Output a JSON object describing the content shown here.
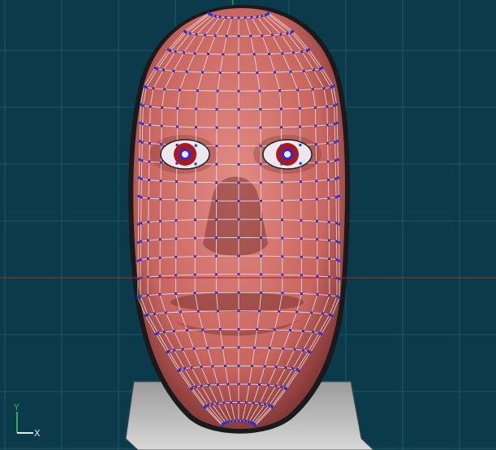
{
  "viewport": {
    "background_color": "#0b3a4a",
    "grid_color": "#1f5566",
    "horizon_axis_color": "#b0242e",
    "vertical_axis_color": "#3aa84b"
  },
  "model": {
    "skin_color": "#d4736f",
    "skin_shade_color": "#8f3f3c",
    "wire_color": "#f6e8e6",
    "vertex_color": "#2a2fd6",
    "iris_color": "#b01818",
    "eye_white_color": "#e8e8ee",
    "neck_color": "#c7c7c7",
    "mesh_rows": 22,
    "mesh_cols": 14
  },
  "axis_gizmo": {
    "y_label": "Y",
    "x_label": "X",
    "y_color": "#3aa84b",
    "x_color": "#e6e6e6"
  }
}
